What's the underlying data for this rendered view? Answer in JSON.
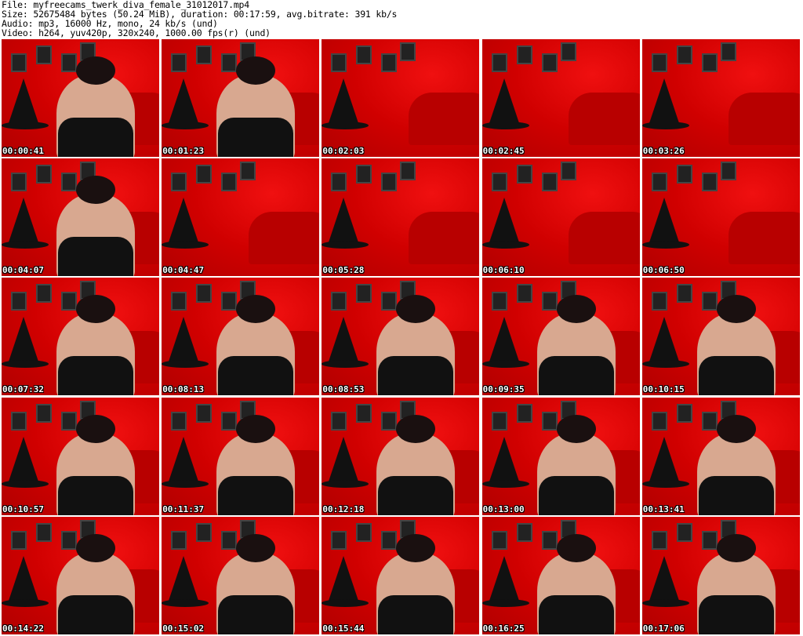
{
  "header": {
    "file_line": "File: myfreecams_twerk_diva_female_31012017.mp4",
    "size_line": "Size: 52675484 bytes (50.24 MiB), duration: 00:17:59, avg.bitrate: 391 kb/s",
    "audio_line": "Audio: mp3, 16000 Hz, mono, 24 kb/s (und)",
    "video_line": "Video: h264, yuv420p, 320x240, 1000.00 fps(r) (und)"
  },
  "thumbnails": [
    {
      "timestamp": "00:00:41",
      "person": true
    },
    {
      "timestamp": "00:01:23",
      "person": true
    },
    {
      "timestamp": "00:02:03",
      "person": false
    },
    {
      "timestamp": "00:02:45",
      "person": false
    },
    {
      "timestamp": "00:03:26",
      "person": false
    },
    {
      "timestamp": "00:04:07",
      "person": true
    },
    {
      "timestamp": "00:04:47",
      "person": false
    },
    {
      "timestamp": "00:05:28",
      "person": false
    },
    {
      "timestamp": "00:06:10",
      "person": false
    },
    {
      "timestamp": "00:06:50",
      "person": false
    },
    {
      "timestamp": "00:07:32",
      "person": true
    },
    {
      "timestamp": "00:08:13",
      "person": true
    },
    {
      "timestamp": "00:08:53",
      "person": true
    },
    {
      "timestamp": "00:09:35",
      "person": true
    },
    {
      "timestamp": "00:10:15",
      "person": true
    },
    {
      "timestamp": "00:10:57",
      "person": true
    },
    {
      "timestamp": "00:11:37",
      "person": true
    },
    {
      "timestamp": "00:12:18",
      "person": true
    },
    {
      "timestamp": "00:13:00",
      "person": true
    },
    {
      "timestamp": "00:13:41",
      "person": true
    },
    {
      "timestamp": "00:14:22",
      "person": true
    },
    {
      "timestamp": "00:15:02",
      "person": true
    },
    {
      "timestamp": "00:15:44",
      "person": true
    },
    {
      "timestamp": "00:16:25",
      "person": true
    },
    {
      "timestamp": "00:17:06",
      "person": true
    }
  ]
}
